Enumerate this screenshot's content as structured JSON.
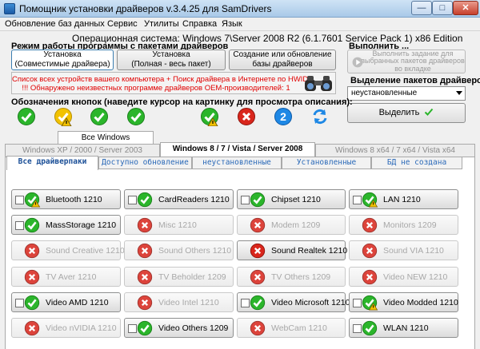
{
  "window": {
    "title": "Помощник установки драйверов v.3.4.25 для SamDrivers",
    "controls": {
      "minimize": "—",
      "maximize": "□",
      "close": "✕"
    }
  },
  "menu": [
    "Обновление баз данных",
    "Сервис",
    "Утилиты",
    "Справка",
    "Язык"
  ],
  "os_info": "Операционная система: Windows 7\\Server 2008 R2  (6.1.7601 Service Pack 1) x86 Edition",
  "mode": {
    "label": "Режим работы программы с пакетами драйверов",
    "buttons": [
      {
        "line1": "Установка",
        "line2": "(Совместимые драйвера)",
        "selected": true
      },
      {
        "line1": "Установка",
        "line2": "(Полная - весь пакет)",
        "selected": false
      },
      {
        "line1": "Создание или обновление",
        "line2": "базы драйверов",
        "selected": false
      }
    ]
  },
  "execute": {
    "label": "Выполнить ...",
    "button_line1": "Выполнить задание для",
    "button_line2": "выбранных пакетов драйверов",
    "button_line3": "во вкладке"
  },
  "banner": {
    "line1": "Список всех устройств вашего компьютера + Поиск драйвера в Интернете по HWID",
    "line2": "!!! Обнаружено неизвестных программе драйверов OEM-производителей: 1"
  },
  "selection": {
    "label": "Выделение пакетов драйверов:",
    "value": "неустановленные",
    "button": "Выделить"
  },
  "legend": {
    "label": "Обозначения кнопок (наведите курсор на картинку для просмотра описания):",
    "icons": [
      "check-icon",
      "check-warning-icon",
      "check-icon",
      "check-icon",
      "check-warning-icon",
      "cross-icon",
      "question-icon",
      "refresh-icon"
    ]
  },
  "group_tab": "Все Windows",
  "os_tabs": [
    {
      "label": "Windows XP / 2000 / Server 2003",
      "active": false
    },
    {
      "label": "Windows 8 / 7 / Vista / Server 2008",
      "active": true
    },
    {
      "label": "Windows 8 x64 / 7 x64 / Vista x64",
      "active": false
    }
  ],
  "pkg_tabs": [
    {
      "label": "Все драйверпаки",
      "active": true
    },
    {
      "label": "Доступно обновление",
      "active": false
    },
    {
      "label": "неустановленные",
      "active": false
    },
    {
      "label": "Установленные",
      "active": false
    },
    {
      "label": "БД не создана",
      "active": false
    }
  ],
  "drivers": [
    {
      "name": "Bluetooth 1210",
      "status": "warn",
      "active": true,
      "checkbox": true
    },
    {
      "name": "CardReaders 1210",
      "status": "ok",
      "active": true,
      "checkbox": true
    },
    {
      "name": "Chipset 1210",
      "status": "ok",
      "active": true,
      "checkbox": true
    },
    {
      "name": "LAN 1210",
      "status": "warn",
      "active": true,
      "checkbox": true
    },
    {
      "name": "MassStorage 1210",
      "status": "ok",
      "active": true,
      "checkbox": true
    },
    {
      "name": "Misc 1210",
      "status": "no",
      "active": false,
      "checkbox": false
    },
    {
      "name": "Modem 1209",
      "status": "no",
      "active": false,
      "checkbox": false
    },
    {
      "name": "Monitors 1209",
      "status": "no",
      "active": false,
      "checkbox": false
    },
    {
      "name": "Sound Creative 1210",
      "status": "no",
      "active": false,
      "checkbox": false
    },
    {
      "name": "Sound Others 1210",
      "status": "no",
      "active": false,
      "checkbox": false
    },
    {
      "name": "Sound Realtek 1210",
      "status": "no",
      "active": true,
      "checkbox": false
    },
    {
      "name": "Sound VIA 1210",
      "status": "no",
      "active": false,
      "checkbox": false
    },
    {
      "name": "TV Aver 1210",
      "status": "no",
      "active": false,
      "checkbox": false
    },
    {
      "name": "TV Beholder 1209",
      "status": "no",
      "active": false,
      "checkbox": false
    },
    {
      "name": "TV Others 1209",
      "status": "no",
      "active": false,
      "checkbox": false
    },
    {
      "name": "Video NEW 1210",
      "status": "no",
      "active": false,
      "checkbox": false
    },
    {
      "name": "Video AMD 1210",
      "status": "ok",
      "active": true,
      "checkbox": true
    },
    {
      "name": "Video Intel 1210",
      "status": "no",
      "active": false,
      "checkbox": false
    },
    {
      "name": "Video Microsoft 1210",
      "status": "ok",
      "active": true,
      "checkbox": true
    },
    {
      "name": "Video Modded 1210",
      "status": "warn",
      "active": true,
      "checkbox": true
    },
    {
      "name": "Video nVIDIA 1210",
      "status": "no",
      "active": false,
      "checkbox": false
    },
    {
      "name": "Video Others 1209",
      "status": "ok",
      "active": true,
      "checkbox": true
    },
    {
      "name": "WebCam 1210",
      "status": "no",
      "active": false,
      "checkbox": false
    },
    {
      "name": "WLAN 1210",
      "status": "ok",
      "active": true,
      "checkbox": true
    }
  ],
  "colors": {
    "ok": "#2bb52b",
    "warn": "#f2c200",
    "no": "#d9261c",
    "info": "#1e88e5",
    "banner_text": "#e00000",
    "tab_text": "#2a69b8"
  }
}
